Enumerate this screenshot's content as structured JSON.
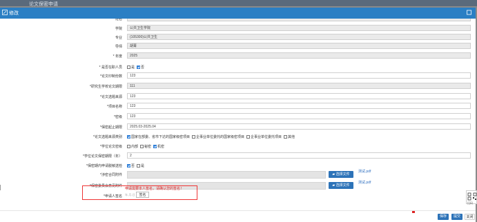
{
  "window": {
    "title": "论文保密申请"
  },
  "modal": {
    "title": "修改"
  },
  "rows": [
    {
      "id": "student-name",
      "label": "姓名",
      "value": "",
      "ro": true
    },
    {
      "id": "college",
      "label": "学院",
      "value": "公共卫生学院",
      "ro": true
    },
    {
      "id": "major",
      "label": "专业",
      "value": "(105300)公共卫生",
      "ro": true
    },
    {
      "id": "advisor",
      "label": "导师",
      "value": "胡菁",
      "ro": true
    },
    {
      "id": "year",
      "label": "* 年度",
      "value": "2025",
      "ro": true
    }
  ],
  "onjob": {
    "label": "* 是否在职人员",
    "options": [
      {
        "text": "是",
        "checked": false
      },
      {
        "text": "否",
        "checked": true
      }
    ]
  },
  "rows2": [
    {
      "id": "print-count",
      "label": "*论文印制份数",
      "value": "123",
      "ro": false
    },
    {
      "id": "grad-period",
      "label": "*研究生学校论文期限",
      "value": "111",
      "ro": true
    },
    {
      "id": "topic-source",
      "label": "*论文选题来源",
      "value": "123",
      "ro": false
    },
    {
      "id": "project-name",
      "label": "*项目名称",
      "value": "123",
      "ro": false
    },
    {
      "id": "secret-level",
      "label": "*密级",
      "value": "123",
      "ro": false
    },
    {
      "id": "secret-period",
      "label": "*保密起止期限",
      "value": "2025.03-2025.04",
      "ro": false
    }
  ],
  "topic_category": {
    "label": "*论文选题来源类别",
    "options": [
      {
        "text": "国家在部委、省市下达的国家级密项目",
        "checked": true
      },
      {
        "text": "企事业单位委托的国家级密项目",
        "checked": false
      },
      {
        "text": "企事业单位委托项目",
        "checked": false
      },
      {
        "text": "其他",
        "checked": false
      }
    ]
  },
  "school_secret": {
    "label": "*学位论文密级",
    "options": [
      {
        "text": "内部",
        "checked": false
      },
      {
        "text": "秘密",
        "checked": false
      },
      {
        "text": "机密",
        "checked": true
      }
    ]
  },
  "secret_years": {
    "label": "*学位论文保密期限（年）",
    "value": "2"
  },
  "apply_extension": {
    "label": "*保密期内申请脱敏送检",
    "options": [
      {
        "text": "否",
        "checked": true
      },
      {
        "text": "是",
        "checked": false
      }
    ]
  },
  "files": [
    {
      "label": "*涉密合同附件",
      "button": "选择文件",
      "link": "测试.pdf"
    },
    {
      "label": "*保密委员会意见附件",
      "button": "选择文件",
      "link": "测试.pdf"
    }
  ],
  "signature": {
    "hint": "申请需要本人签名，请确认您的签名！",
    "date": "年-月-日",
    "button": "签名",
    "label": "*申请人签名"
  },
  "side": {
    "label": "扫码"
  },
  "footer": {
    "save": "保存",
    "submit": "提交",
    "close": "关闭"
  },
  "colors": {
    "header": "#2b7fc4",
    "button": "#2d73b8",
    "highlight": "#e33"
  }
}
